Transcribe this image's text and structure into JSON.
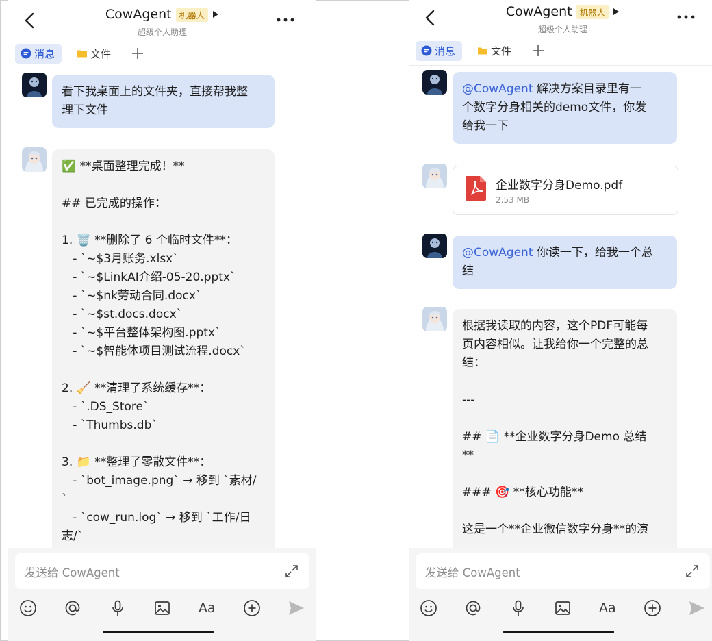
{
  "colors": {
    "accent": "#2d5bd6",
    "user_bubble": "#d9e4f9",
    "bot_bubble": "#f3f3f4",
    "badge_bg": "#fbefc5",
    "badge_text": "#b07a06",
    "pdf_red": "#e0403a"
  },
  "header": {
    "title": "CowAgent",
    "badge": "机器人",
    "subtitle": "超级个人助理",
    "tabs": [
      "消息",
      "文件"
    ]
  },
  "composer": {
    "placeholder": "发送给 CowAgent",
    "font_tool_label": "Aa"
  },
  "left": {
    "user_message": [
      "看下我桌面上的文件夹，直接帮我整",
      "理下文件"
    ],
    "bot_message": [
      "✅ **桌面整理完成！**",
      "",
      "## 已完成的操作：",
      "",
      "1. 🗑️ **删除了 6 个临时文件**：",
      "   - `~$3月账务.xlsx`",
      "   - `~$LinkAI介绍-05-20.pptx`",
      "   - `~$nk劳动合同.docx`",
      "   - `~$st.docs.docx`",
      "   - `~$平台整体架构图.pptx`",
      "   - `~$智能体项目测试流程.docx`",
      "",
      "2. 🧹 **清理了系统缓存**：",
      "   - `.DS_Store`",
      "   - `Thumbs.db`",
      "",
      "3. 📁 **整理了零散文件**：",
      "   - `bot_image.png` → 移到 `素材/",
      "`",
      "   - `cow_run.log` → 移到 `工作/日",
      "志/`"
    ]
  },
  "right": {
    "user_message_1": {
      "mention": "@CowAgent",
      "line1": " 解决方案目录里有一",
      "line2": "个数字分身相关的demo文件，你发",
      "line3": "给我一下"
    },
    "file": {
      "name": "企业数字分身Demo.pdf",
      "size": "2.53 MB"
    },
    "user_message_2": {
      "mention": "@CowAgent",
      "line1": " 你读一下，给我一个总",
      "line2": "结"
    },
    "bot_message": [
      "根据我读取的内容，这个PDF可能每",
      "页内容相似。让我给你一个完整的总",
      "结：",
      "",
      "---",
      "",
      "## 📄 **企业数字分身Demo 总结",
      "**",
      "",
      "### 🎯 **核心功能**",
      "",
      "这是一个**企业微信数字分身**的演"
    ]
  }
}
